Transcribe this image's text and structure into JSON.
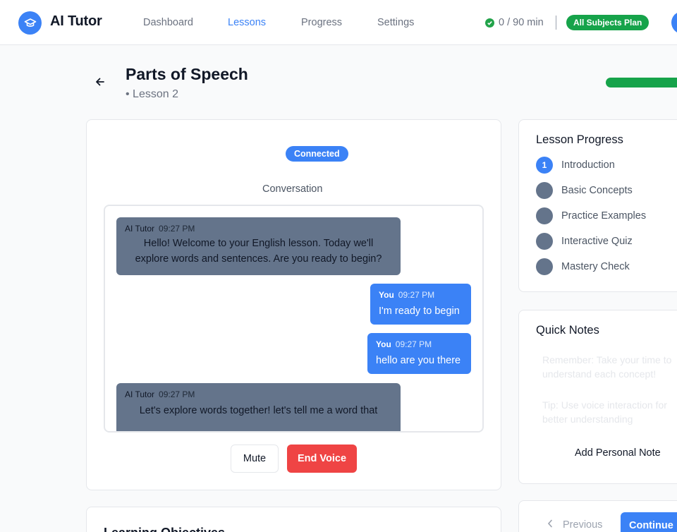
{
  "header": {
    "app_title": "AI Tutor",
    "nav": [
      {
        "label": "Dashboard",
        "active": false
      },
      {
        "label": "Lessons",
        "active": true
      },
      {
        "label": "Progress",
        "active": false
      },
      {
        "label": "Settings",
        "active": false
      }
    ],
    "usage": "0 / 90 min",
    "plan_badge": "All Subjects Plan"
  },
  "lesson": {
    "title": "Parts of Speech",
    "subtitle": "• Lesson 2"
  },
  "chat": {
    "status_badge": "Connected",
    "section_label": "Conversation",
    "messages": [
      {
        "sender": "AI Tutor",
        "time": "09:27 PM",
        "text_line1": "Hello! Welcome to your English lesson. Today we'll",
        "text_line2": "explore words and sentences. Are you ready to begin?"
      },
      {
        "sender": "You",
        "time": "09:27 PM",
        "text": "I'm ready to begin"
      },
      {
        "sender": "You",
        "time": "09:27 PM",
        "text": "hello are you there"
      },
      {
        "sender": "AI Tutor",
        "time": "09:27 PM",
        "text_line1": "Let's explore words together! let's tell me a word that"
      }
    ],
    "mute_label": "Mute",
    "end_voice_label": "End Voice"
  },
  "objectives": {
    "title": "Learning Objectives"
  },
  "lesson_progress": {
    "heading": "Lesson Progress",
    "steps": [
      {
        "number": "1",
        "label": "Introduction",
        "active": true
      },
      {
        "number": "",
        "label": "Basic Concepts",
        "active": false
      },
      {
        "number": "",
        "label": "Practice Examples",
        "active": false
      },
      {
        "number": "",
        "label": "Interactive Quiz",
        "active": false
      },
      {
        "number": "",
        "label": "Mastery Check",
        "active": false
      }
    ]
  },
  "quick_notes": {
    "heading": "Quick Notes",
    "note1_line1": "Remember: Take your time to",
    "note1_line2": "understand each concept!",
    "note2_line1": "Tip: Use voice interaction for",
    "note2_line2": "better understanding",
    "add_note_label": "Add Personal Note"
  },
  "navigation": {
    "previous_label": "Previous",
    "continue_label": "Continue"
  },
  "colors": {
    "accent": "#3b82f6",
    "success": "#16a34a",
    "danger": "#ef4444",
    "tutor_bubble": "#64748b"
  }
}
